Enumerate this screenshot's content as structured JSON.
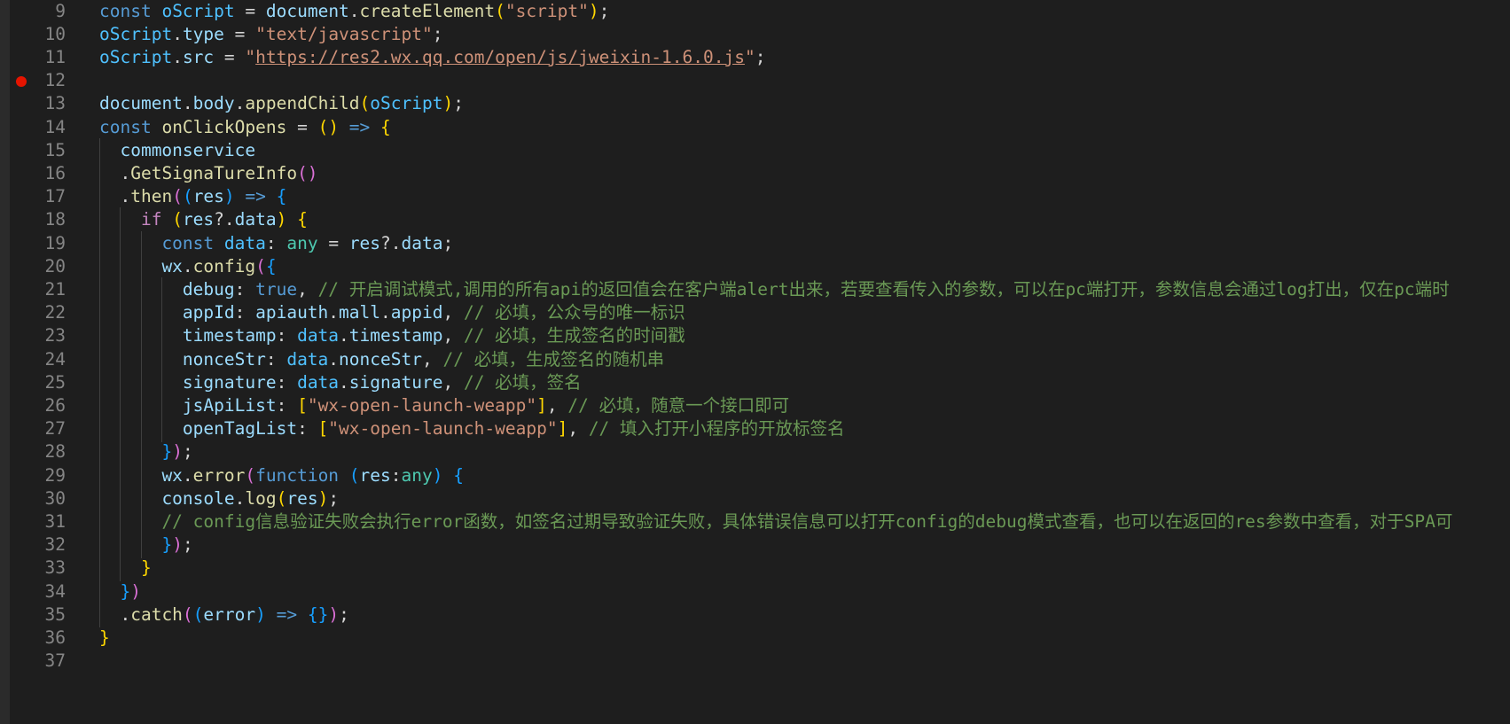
{
  "editor": {
    "breakpoint_line": 12,
    "lines": [
      {
        "n": "9",
        "indent": 0,
        "tokens": [
          {
            "t": "const ",
            "c": "kw"
          },
          {
            "t": "oScript",
            "c": "const"
          },
          {
            "t": " = ",
            "c": ""
          },
          {
            "t": "document",
            "c": "var"
          },
          {
            "t": ".",
            "c": ""
          },
          {
            "t": "createElement",
            "c": "fn"
          },
          {
            "t": "(",
            "c": "p1"
          },
          {
            "t": "\"script\"",
            "c": "str"
          },
          {
            "t": ")",
            "c": "p1"
          },
          {
            "t": ";",
            "c": ""
          }
        ]
      },
      {
        "n": "10",
        "indent": 0,
        "tokens": [
          {
            "t": "oScript",
            "c": "const"
          },
          {
            "t": ".",
            "c": ""
          },
          {
            "t": "type",
            "c": "var"
          },
          {
            "t": " = ",
            "c": ""
          },
          {
            "t": "\"text/javascript\"",
            "c": "str"
          },
          {
            "t": ";",
            "c": ""
          }
        ]
      },
      {
        "n": "11",
        "indent": 0,
        "tokens": [
          {
            "t": "oScript",
            "c": "const"
          },
          {
            "t": ".",
            "c": ""
          },
          {
            "t": "src",
            "c": "var"
          },
          {
            "t": " = ",
            "c": ""
          },
          {
            "t": "\"",
            "c": "str"
          },
          {
            "t": "https://res2.wx.qq.com/open/js/jweixin-1.6.0.js",
            "c": "url"
          },
          {
            "t": "\"",
            "c": "str"
          },
          {
            "t": ";",
            "c": ""
          }
        ]
      },
      {
        "n": "12",
        "indent": 0,
        "tokens": []
      },
      {
        "n": "13",
        "indent": 0,
        "tokens": [
          {
            "t": "document",
            "c": "var"
          },
          {
            "t": ".",
            "c": ""
          },
          {
            "t": "body",
            "c": "var"
          },
          {
            "t": ".",
            "c": ""
          },
          {
            "t": "appendChild",
            "c": "fn"
          },
          {
            "t": "(",
            "c": "p1"
          },
          {
            "t": "oScript",
            "c": "const"
          },
          {
            "t": ")",
            "c": "p1"
          },
          {
            "t": ";",
            "c": ""
          }
        ]
      },
      {
        "n": "14",
        "indent": 0,
        "tokens": [
          {
            "t": "const ",
            "c": "kw"
          },
          {
            "t": "onClickOpens",
            "c": "fn"
          },
          {
            "t": " = ",
            "c": ""
          },
          {
            "t": "()",
            "c": "p1"
          },
          {
            "t": " => ",
            "c": "kw"
          },
          {
            "t": "{",
            "c": "p1"
          }
        ]
      },
      {
        "n": "15",
        "indent": 1,
        "tokens": [
          {
            "t": "commonservice",
            "c": "var"
          }
        ]
      },
      {
        "n": "16",
        "indent": 1,
        "tokens": [
          {
            "t": ".",
            "c": ""
          },
          {
            "t": "GetSignaTureInfo",
            "c": "fn"
          },
          {
            "t": "()",
            "c": "p2"
          }
        ]
      },
      {
        "n": "17",
        "indent": 1,
        "tokens": [
          {
            "t": ".",
            "c": ""
          },
          {
            "t": "then",
            "c": "fn"
          },
          {
            "t": "(",
            "c": "p2"
          },
          {
            "t": "(",
            "c": "p3"
          },
          {
            "t": "res",
            "c": "var"
          },
          {
            "t": ")",
            "c": "p3"
          },
          {
            "t": " => ",
            "c": "kw"
          },
          {
            "t": "{",
            "c": "p3"
          }
        ]
      },
      {
        "n": "18",
        "indent": 2,
        "tokens": [
          {
            "t": "if ",
            "c": "ctl"
          },
          {
            "t": "(",
            "c": "p1"
          },
          {
            "t": "res",
            "c": "var"
          },
          {
            "t": "?.",
            "c": ""
          },
          {
            "t": "data",
            "c": "var"
          },
          {
            "t": ")",
            "c": "p1"
          },
          {
            "t": " ",
            "c": ""
          },
          {
            "t": "{",
            "c": "p1"
          }
        ]
      },
      {
        "n": "19",
        "indent": 3,
        "tokens": [
          {
            "t": "const ",
            "c": "kw"
          },
          {
            "t": "data",
            "c": "const"
          },
          {
            "t": ": ",
            "c": ""
          },
          {
            "t": "any",
            "c": "type"
          },
          {
            "t": " = ",
            "c": ""
          },
          {
            "t": "res",
            "c": "var"
          },
          {
            "t": "?.",
            "c": ""
          },
          {
            "t": "data",
            "c": "var"
          },
          {
            "t": ";",
            "c": ""
          }
        ]
      },
      {
        "n": "20",
        "indent": 3,
        "tokens": [
          {
            "t": "wx",
            "c": "var"
          },
          {
            "t": ".",
            "c": ""
          },
          {
            "t": "config",
            "c": "fn"
          },
          {
            "t": "(",
            "c": "p2"
          },
          {
            "t": "{",
            "c": "p3"
          }
        ]
      },
      {
        "n": "21",
        "indent": 4,
        "tokens": [
          {
            "t": "debug",
            "c": "var"
          },
          {
            "t": ": ",
            "c": ""
          },
          {
            "t": "true",
            "c": "kw"
          },
          {
            "t": ", ",
            "c": ""
          },
          {
            "t": "// 开启调试模式,调用的所有api的返回值会在客户端alert出来，若要查看传入的参数，可以在pc端打开，参数信息会通过log打出，仅在pc端时",
            "c": "cmt"
          }
        ]
      },
      {
        "n": "22",
        "indent": 4,
        "tokens": [
          {
            "t": "appId",
            "c": "var"
          },
          {
            "t": ": ",
            "c": ""
          },
          {
            "t": "apiauth",
            "c": "var"
          },
          {
            "t": ".",
            "c": ""
          },
          {
            "t": "mall",
            "c": "var"
          },
          {
            "t": ".",
            "c": ""
          },
          {
            "t": "appid",
            "c": "var"
          },
          {
            "t": ", ",
            "c": ""
          },
          {
            "t": "// 必填，公众号的唯一标识",
            "c": "cmt"
          }
        ]
      },
      {
        "n": "23",
        "indent": 4,
        "tokens": [
          {
            "t": "timestamp",
            "c": "var"
          },
          {
            "t": ": ",
            "c": ""
          },
          {
            "t": "data",
            "c": "const"
          },
          {
            "t": ".",
            "c": ""
          },
          {
            "t": "timestamp",
            "c": "var"
          },
          {
            "t": ", ",
            "c": ""
          },
          {
            "t": "// 必填，生成签名的时间戳",
            "c": "cmt"
          }
        ]
      },
      {
        "n": "24",
        "indent": 4,
        "tokens": [
          {
            "t": "nonceStr",
            "c": "var"
          },
          {
            "t": ": ",
            "c": ""
          },
          {
            "t": "data",
            "c": "const"
          },
          {
            "t": ".",
            "c": ""
          },
          {
            "t": "nonceStr",
            "c": "var"
          },
          {
            "t": ", ",
            "c": ""
          },
          {
            "t": "// 必填，生成签名的随机串",
            "c": "cmt"
          }
        ]
      },
      {
        "n": "25",
        "indent": 4,
        "tokens": [
          {
            "t": "signature",
            "c": "var"
          },
          {
            "t": ": ",
            "c": ""
          },
          {
            "t": "data",
            "c": "const"
          },
          {
            "t": ".",
            "c": ""
          },
          {
            "t": "signature",
            "c": "var"
          },
          {
            "t": ", ",
            "c": ""
          },
          {
            "t": "// 必填，签名",
            "c": "cmt"
          }
        ]
      },
      {
        "n": "26",
        "indent": 4,
        "tokens": [
          {
            "t": "jsApiList",
            "c": "var"
          },
          {
            "t": ": ",
            "c": ""
          },
          {
            "t": "[",
            "c": "p1"
          },
          {
            "t": "\"wx-open-launch-weapp\"",
            "c": "str"
          },
          {
            "t": "]",
            "c": "p1"
          },
          {
            "t": ", ",
            "c": ""
          },
          {
            "t": "// 必填，随意一个接口即可",
            "c": "cmt"
          }
        ]
      },
      {
        "n": "27",
        "indent": 4,
        "tokens": [
          {
            "t": "openTagList",
            "c": "var"
          },
          {
            "t": ": ",
            "c": ""
          },
          {
            "t": "[",
            "c": "p1"
          },
          {
            "t": "\"wx-open-launch-weapp\"",
            "c": "str"
          },
          {
            "t": "]",
            "c": "p1"
          },
          {
            "t": ", ",
            "c": ""
          },
          {
            "t": "// 填入打开小程序的开放标签名",
            "c": "cmt"
          }
        ]
      },
      {
        "n": "28",
        "indent": 3,
        "tokens": [
          {
            "t": "}",
            "c": "p3"
          },
          {
            "t": ")",
            "c": "p2"
          },
          {
            "t": ";",
            "c": ""
          }
        ]
      },
      {
        "n": "29",
        "indent": 3,
        "tokens": [
          {
            "t": "wx",
            "c": "var"
          },
          {
            "t": ".",
            "c": ""
          },
          {
            "t": "error",
            "c": "fn"
          },
          {
            "t": "(",
            "c": "p2"
          },
          {
            "t": "function ",
            "c": "kw"
          },
          {
            "t": "(",
            "c": "p3"
          },
          {
            "t": "res",
            "c": "var"
          },
          {
            "t": ":",
            "c": ""
          },
          {
            "t": "any",
            "c": "type"
          },
          {
            "t": ")",
            "c": "p3"
          },
          {
            "t": " ",
            "c": ""
          },
          {
            "t": "{",
            "c": "p3"
          }
        ]
      },
      {
        "n": "30",
        "indent": 3,
        "tokens": [
          {
            "t": "console",
            "c": "var"
          },
          {
            "t": ".",
            "c": ""
          },
          {
            "t": "log",
            "c": "fn"
          },
          {
            "t": "(",
            "c": "p1"
          },
          {
            "t": "res",
            "c": "var"
          },
          {
            "t": ")",
            "c": "p1"
          },
          {
            "t": ";",
            "c": ""
          }
        ]
      },
      {
        "n": "31",
        "indent": 3,
        "tokens": [
          {
            "t": "// config信息验证失败会执行error函数，如签名过期导致验证失败，具体错误信息可以打开config的debug模式查看，也可以在返回的res参数中查看，对于SPA可",
            "c": "cmt"
          }
        ]
      },
      {
        "n": "32",
        "indent": 3,
        "tokens": [
          {
            "t": "}",
            "c": "p3"
          },
          {
            "t": ")",
            "c": "p2"
          },
          {
            "t": ";",
            "c": ""
          }
        ]
      },
      {
        "n": "33",
        "indent": 2,
        "tokens": [
          {
            "t": "}",
            "c": "p1"
          }
        ]
      },
      {
        "n": "34",
        "indent": 1,
        "tokens": [
          {
            "t": "}",
            "c": "p3"
          },
          {
            "t": ")",
            "c": "p2"
          }
        ]
      },
      {
        "n": "35",
        "indent": 1,
        "tokens": [
          {
            "t": ".",
            "c": ""
          },
          {
            "t": "catch",
            "c": "fn"
          },
          {
            "t": "(",
            "c": "p2"
          },
          {
            "t": "(",
            "c": "p3"
          },
          {
            "t": "error",
            "c": "var"
          },
          {
            "t": ")",
            "c": "p3"
          },
          {
            "t": " => ",
            "c": "kw"
          },
          {
            "t": "{}",
            "c": "p3"
          },
          {
            "t": ")",
            "c": "p2"
          },
          {
            "t": ";",
            "c": ""
          }
        ]
      },
      {
        "n": "36",
        "indent": 0,
        "tokens": [
          {
            "t": "}",
            "c": "p1"
          }
        ]
      },
      {
        "n": "37",
        "indent": 0,
        "tokens": []
      }
    ]
  }
}
